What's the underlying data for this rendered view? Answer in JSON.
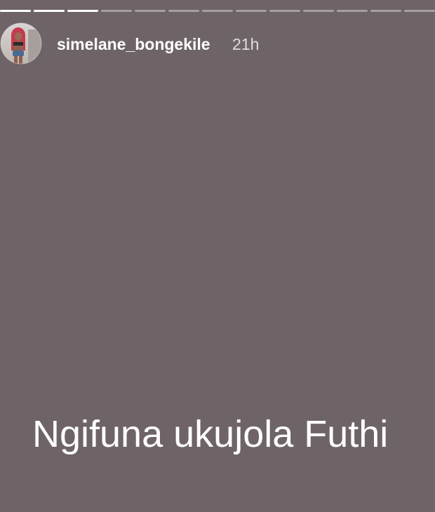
{
  "story": {
    "username": "simelane_bongekile",
    "timestamp": "21h",
    "caption": "Ngifuna ukujola Futhi",
    "background_color": "#6e6467",
    "progress": {
      "segments_total": 13,
      "segments_seen": 3,
      "current_segment_fraction": 0.0
    }
  },
  "icons": {
    "avatar": "profile-photo"
  }
}
